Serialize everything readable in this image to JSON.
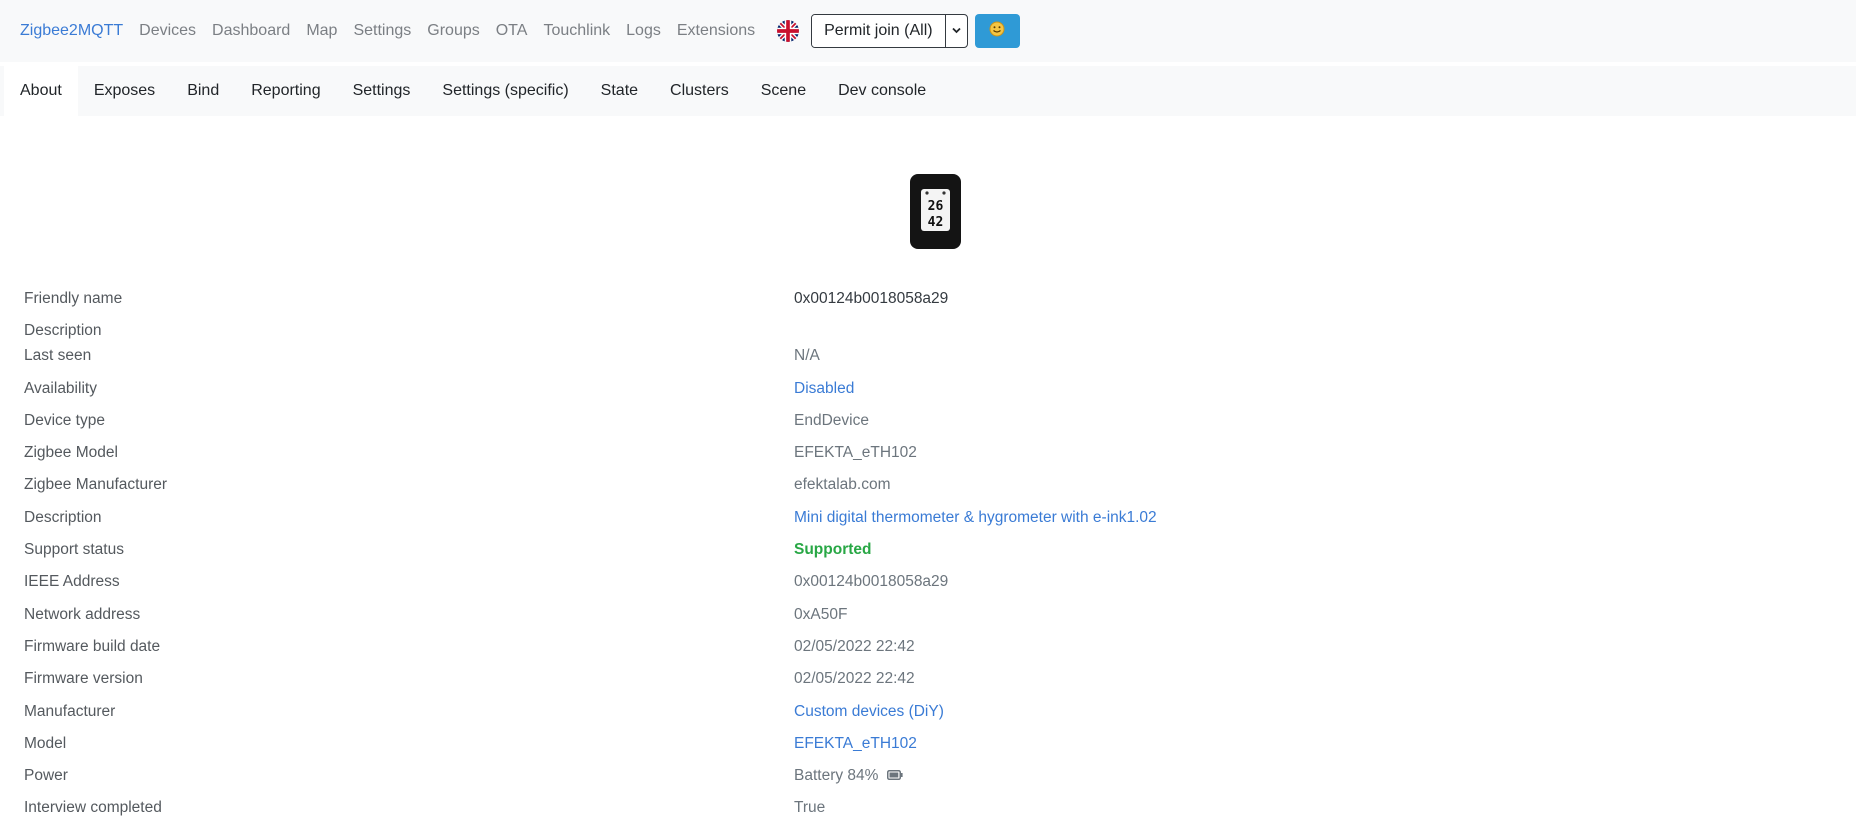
{
  "nav": {
    "brand": "Zigbee2MQTT",
    "links": [
      "Devices",
      "Dashboard",
      "Map",
      "Settings",
      "Groups",
      "OTA",
      "Touchlink",
      "Logs",
      "Extensions"
    ],
    "language_icon": "uk-flag-icon",
    "permit_join_label": "Permit join (All)",
    "user_icon": "smiley-icon"
  },
  "tabs": [
    {
      "label": "About",
      "active": true
    },
    {
      "label": "Exposes"
    },
    {
      "label": "Bind"
    },
    {
      "label": "Reporting"
    },
    {
      "label": "Settings"
    },
    {
      "label": "Settings (specific)"
    },
    {
      "label": "State"
    },
    {
      "label": "Clusters"
    },
    {
      "label": "Scene"
    },
    {
      "label": "Dev console"
    }
  ],
  "device_image": {
    "line1": "26",
    "line2": "42"
  },
  "device": {
    "rows": [
      {
        "label": "Friendly name",
        "value": "0x00124b0018058a29",
        "style": "dark"
      },
      {
        "label": "Description",
        "value": ""
      },
      {
        "label": "Last seen",
        "value": "N/A"
      },
      {
        "label": "Availability",
        "value": "Disabled",
        "style": "link"
      },
      {
        "label": "Device type",
        "value": "EndDevice"
      },
      {
        "label": "Zigbee Model",
        "value": "EFEKTA_eTH102"
      },
      {
        "label": "Zigbee Manufacturer",
        "value": "efektalab.com"
      },
      {
        "label": "Description",
        "value": "Mini digital thermometer & hygrometer with e-ink1.02",
        "style": "link"
      },
      {
        "label": "Support status",
        "value": "Supported",
        "style": "success"
      },
      {
        "label": "IEEE Address",
        "value": "0x00124b0018058a29"
      },
      {
        "label": "Network address",
        "value": "0xA50F"
      },
      {
        "label": "Firmware build date",
        "value": "02/05/2022 22:42"
      },
      {
        "label": "Firmware version",
        "value": "02/05/2022 22:42"
      },
      {
        "label": "Manufacturer",
        "value": "Custom devices (DiY)",
        "style": "link"
      },
      {
        "label": "Model",
        "value": "EFEKTA_eTH102",
        "style": "link"
      },
      {
        "label": "Power",
        "value": "Battery 84%",
        "icon": "battery-icon"
      },
      {
        "label": "Interview completed",
        "value": "True"
      }
    ]
  },
  "colors": {
    "brand": "#3a7bd5",
    "link": "#3a7bd5",
    "success": "#28a745",
    "user_button": "#2f9ad6"
  }
}
